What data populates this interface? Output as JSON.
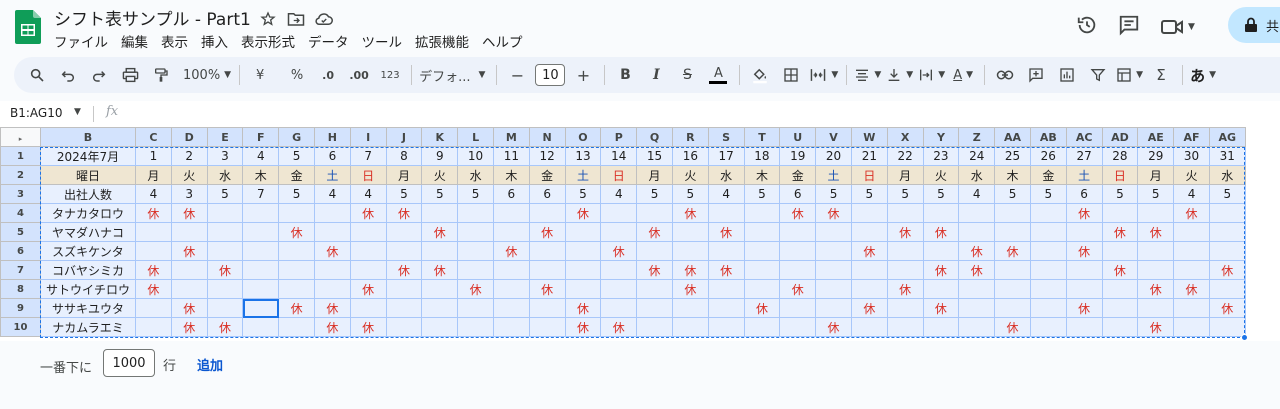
{
  "title_bar": {
    "doc_title": "シフト表サンプル - Part1",
    "share_label": "共"
  },
  "menu": [
    "ファイル",
    "編集",
    "表示",
    "挿入",
    "表示形式",
    "データ",
    "ツール",
    "拡張機能",
    "ヘルプ"
  ],
  "toolbar": {
    "zoom": "100%",
    "currency": "¥",
    "percent": "%",
    "dec_decrease": ".0",
    "dec_increase": ".00",
    "number_format": "123",
    "font": "デフォ...",
    "font_size": "10",
    "bold": "B",
    "italic": "I",
    "strike": "S",
    "text_color": "A",
    "text_rotate_color": "A",
    "input_tools": "あ"
  },
  "formula_bar": {
    "name_box": "B1:AG10",
    "fx": "fx",
    "formula": ""
  },
  "sheet": {
    "col_headers": [
      "B",
      "C",
      "D",
      "E",
      "F",
      "G",
      "H",
      "I",
      "J",
      "K",
      "L",
      "M",
      "N",
      "O",
      "P",
      "Q",
      "R",
      "S",
      "T",
      "U",
      "V",
      "W",
      "X",
      "Y",
      "Z",
      "AA",
      "AB",
      "AC",
      "AD",
      "AE",
      "AF",
      "AG"
    ],
    "row_headers": [
      "1",
      "2",
      "3",
      "4",
      "5",
      "6",
      "7",
      "8",
      "9",
      "10"
    ],
    "header_cell": "2024年7月",
    "day_numbers": [
      "1",
      "2",
      "3",
      "4",
      "5",
      "6",
      "7",
      "8",
      "9",
      "10",
      "11",
      "12",
      "13",
      "14",
      "15",
      "16",
      "17",
      "18",
      "19",
      "20",
      "21",
      "22",
      "23",
      "24",
      "25",
      "26",
      "27",
      "28",
      "29",
      "30",
      "31"
    ],
    "weekday_label": "曜日",
    "weekdays": [
      "月",
      "火",
      "水",
      "木",
      "金",
      "土",
      "日",
      "月",
      "火",
      "水",
      "木",
      "金",
      "土",
      "日",
      "月",
      "火",
      "水",
      "木",
      "金",
      "土",
      "日",
      "月",
      "火",
      "水",
      "木",
      "金",
      "土",
      "日",
      "月",
      "火",
      "水"
    ],
    "count_label": "出社人数",
    "counts": [
      "4",
      "3",
      "5",
      "7",
      "5",
      "4",
      "4",
      "5",
      "5",
      "5",
      "6",
      "6",
      "5",
      "4",
      "5",
      "5",
      "4",
      "5",
      "6",
      "5",
      "5",
      "5",
      "5",
      "4",
      "5",
      "5",
      "6",
      "5",
      "5",
      "4",
      "5"
    ],
    "off_mark": "休",
    "staff": [
      {
        "name": "タナカタロウ",
        "off": [
          1,
          2,
          7,
          8,
          13,
          16,
          19,
          20,
          27,
          30
        ]
      },
      {
        "name": "ヤマダハナコ",
        "off": [
          5,
          9,
          12,
          15,
          17,
          22,
          23,
          28,
          29
        ]
      },
      {
        "name": "スズキケンタ",
        "off": [
          2,
          6,
          11,
          14,
          21,
          24,
          25,
          27
        ]
      },
      {
        "name": "コバヤシミカ",
        "off": [
          1,
          3,
          8,
          9,
          15,
          16,
          17,
          23,
          24,
          28,
          31
        ]
      },
      {
        "name": "サトウイチロウ",
        "off": [
          1,
          7,
          10,
          12,
          16,
          19,
          22,
          29,
          30
        ]
      },
      {
        "name": "ササキユウタ",
        "off": [
          2,
          5,
          6,
          13,
          18,
          21,
          23,
          27,
          31
        ]
      },
      {
        "name": "ナカムラエミ",
        "off": [
          2,
          3,
          6,
          7,
          13,
          14,
          20,
          25,
          29
        ]
      }
    ]
  },
  "footer": {
    "label": "一番下に",
    "rows_value": "1000",
    "unit": "行",
    "add_button": "追加"
  }
}
